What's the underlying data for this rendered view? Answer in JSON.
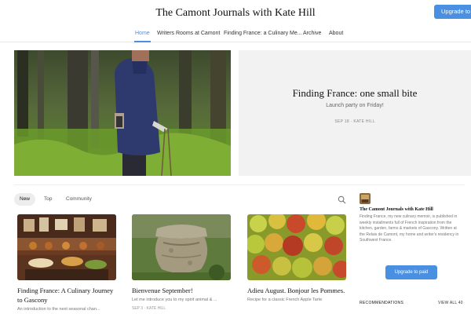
{
  "header": {
    "site_title": "The Camont Journals with Kate Hill",
    "upgrade_label": "Upgrade to paid"
  },
  "nav": {
    "items": [
      {
        "label": "Home",
        "active": true
      },
      {
        "label": "Writers Rooms at Camont"
      },
      {
        "label": "Finding France: a Culinary Me..."
      },
      {
        "label": "Archive"
      },
      {
        "label": "About"
      }
    ]
  },
  "hero": {
    "title": "Finding France: one small bite",
    "subtitle": "Launch party on Friday!",
    "meta": "SEP 18 · KATE HILL"
  },
  "tabs": [
    "New",
    "Top",
    "Community"
  ],
  "posts": [
    {
      "title": "Finding France: A Culinary Journey to Gascony",
      "subtitle": "An introduction to the next seasonal chan..."
    },
    {
      "title": "Bienvenue September!",
      "subtitle": "Let me introduce you to my spirit animal & ...",
      "meta": "SEP 3 · KATE HILL"
    },
    {
      "title": "Adieu August. Bonjour les Pommes.",
      "subtitle": "Recipe for a classic French Apple Tarte"
    }
  ],
  "sidebar": {
    "name": "The Camont Journals with Kate Hill",
    "description": "Finding France, my new culinary memoir, is published in weekly installments full of French inspiration from the kitchen, garden, farms & markets of Gascony. Written at the Relais de Camont, my home and writer's residency in Southwest France.",
    "upgrade_label": "Upgrade to paid",
    "recommendations_label": "RECOMMENDATIONS",
    "view_all_label": "VIEW ALL 40"
  },
  "colors": {
    "accent": "#4a90e2",
    "hero_bg": "#f2f2f2"
  }
}
